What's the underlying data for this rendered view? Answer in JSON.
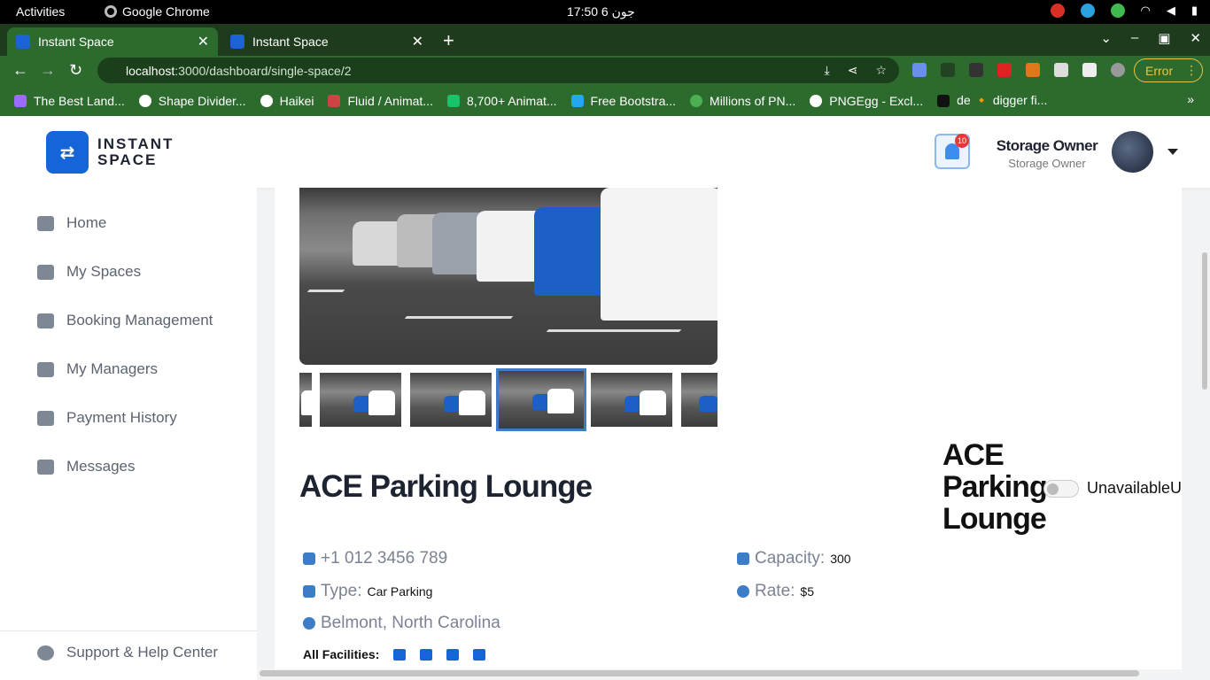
{
  "os": {
    "activities": "Activities",
    "app_name": "Google Chrome",
    "clock": "17:50  6 جون"
  },
  "browser": {
    "tabs": [
      {
        "label": "Instant Space"
      },
      {
        "label": "Instant Space"
      }
    ],
    "url_host": "localhost",
    "url_path": ":3000/dashboard/single-space/2",
    "error_label": "Error",
    "bookmarks": [
      {
        "label": "The Best Land..."
      },
      {
        "label": "Shape Divider..."
      },
      {
        "label": "Haikei"
      },
      {
        "label": "Fluid / Animat..."
      },
      {
        "label": "8,700+ Animat..."
      },
      {
        "label": "Free Bootstra..."
      },
      {
        "label": "Millions of PN..."
      },
      {
        "label": "PNGEgg - Excl..."
      },
      {
        "label": "de 🔸 digger fi..."
      }
    ]
  },
  "header": {
    "logo_line1": "INSTANT",
    "logo_line2": "SPACE",
    "notification_count": "10",
    "user_name": "Storage Owner",
    "user_role": "Storage Owner"
  },
  "sidebar": {
    "items": [
      {
        "label": "Home",
        "icon": "home-icon"
      },
      {
        "label": "My Spaces",
        "icon": "spaces-icon"
      },
      {
        "label": "Booking Management",
        "icon": "booking-icon"
      },
      {
        "label": "My Managers",
        "icon": "managers-icon"
      },
      {
        "label": "Payment History",
        "icon": "payment-icon"
      },
      {
        "label": "Messages",
        "icon": "messages-icon"
      }
    ],
    "support_label": "Support & Help Center"
  },
  "space": {
    "title": "ACE Parking Lounge",
    "side_title": "ACE Parking Lounge",
    "status_label": "UnavailableUna",
    "phone": "+1 012 3456 789",
    "type_label": "Type:",
    "type_value": "Car Parking",
    "location": "Belmont, North Carolina",
    "capacity_label": "Capacity:",
    "capacity_value": "300",
    "rate_label": "Rate:",
    "rate_value": "$5",
    "facilities_label": "All Facilities:"
  },
  "colors": {
    "brand": "#1565d8",
    "chrome_tab": "#2d6a2d",
    "accent_outline": "#3d7cc6"
  }
}
